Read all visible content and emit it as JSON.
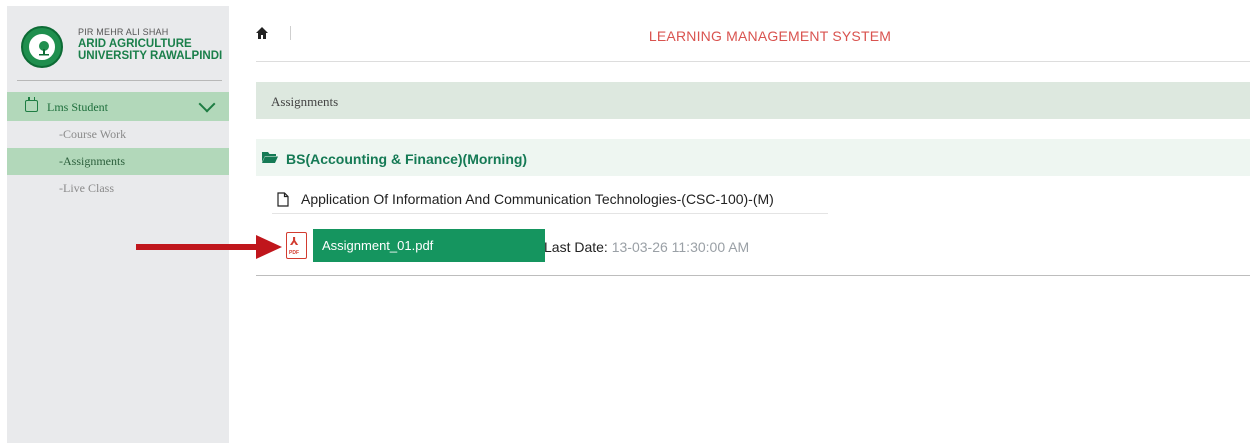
{
  "brand": {
    "line1": "PIR MEHR ALI SHAH",
    "line2": "ARID AGRICULTURE",
    "line3": "UNIVERSITY RAWALPINDI"
  },
  "sidebar": {
    "section_label": "Lms Student",
    "items": [
      {
        "label": "-Course Work",
        "active": false
      },
      {
        "label": "-Assignments",
        "active": true
      },
      {
        "label": "-Live Class",
        "active": false
      }
    ]
  },
  "header": {
    "title": "LEARNING MANAGEMENT SYSTEM",
    "home_icon": "home-icon"
  },
  "breadcrumb": {
    "label": "Assignments"
  },
  "program": {
    "label": "BS(Accounting & Finance)(Morning)",
    "icon": "folder-open-icon"
  },
  "course": {
    "label": "Application Of Information And Communication Technologies-(CSC-100)-(M)",
    "icon": "file-icon"
  },
  "assignment": {
    "file_label": "Assignment_01.pdf",
    "last_date_label": "Last Date:",
    "last_date_value": "13-03-26 11:30:00 AM",
    "icon": "pdf-icon"
  },
  "colors": {
    "accent_green": "#15955f",
    "header_red": "#d9534f",
    "sidebar_active": "#b2d8ba",
    "arrow_red": "#c0161c"
  }
}
